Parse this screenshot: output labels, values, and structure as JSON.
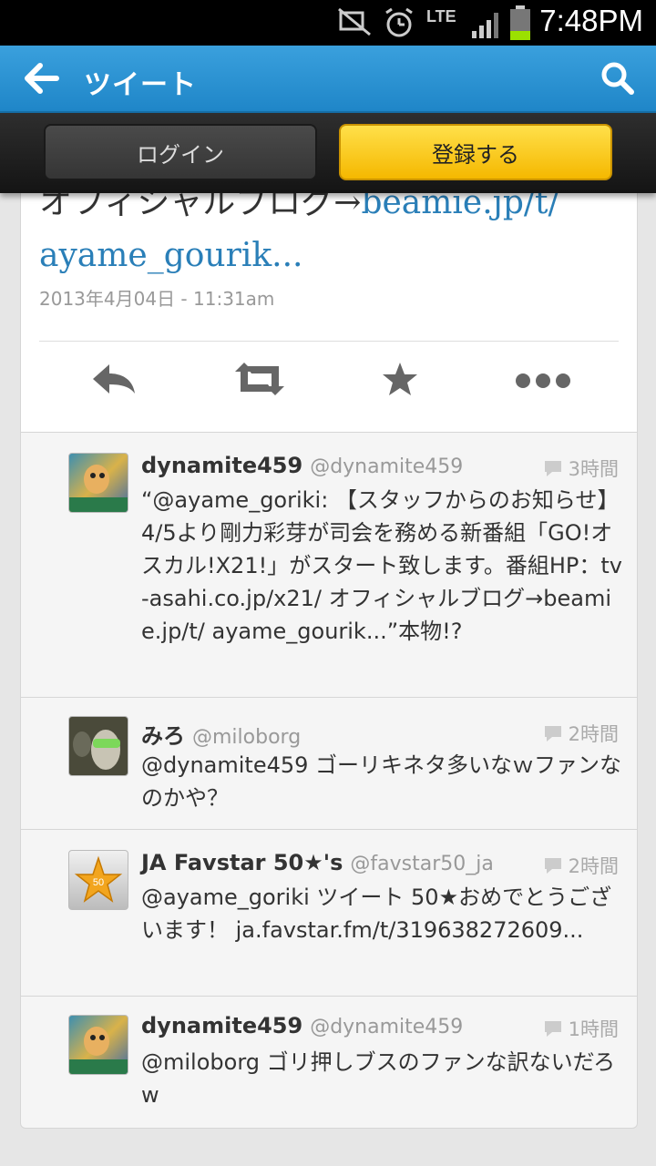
{
  "status_bar": {
    "network": "LTE",
    "time": "7:48PM",
    "icons": [
      "mute-icon",
      "alarm-icon",
      "lte-icon",
      "signal-icon",
      "battery-icon"
    ]
  },
  "app_bar": {
    "title": "ツイート",
    "icons": [
      "back-arrow-icon",
      "search-icon"
    ],
    "color": "#2a93d5"
  },
  "login_bar": {
    "login_label": "ログイン",
    "signup_label": "登録する",
    "signup_color": "#f7c100"
  },
  "tweet": {
    "text_tail_plain": "オフィシャルブログ→",
    "text_tail_link": "beamie.jp/t/",
    "text_tail_link2": "ayame_gourik...",
    "date": "2013年4月04日 - 11:31am",
    "link_color": "#2a7fb8",
    "actions": [
      "reply-icon",
      "retweet-icon",
      "favorite-star-icon",
      "more-icon"
    ]
  },
  "replies": [
    {
      "name": "dynamite459",
      "handle": "@dynamite459",
      "time": "3時間",
      "text": "“@ayame_goriki: 【スタッフからのお知らせ】4/5より剛力彩芽が司会を務める新番組「GO!オスカル!X21!」がスタート致します。番組HP：tv-asahi.co.jp/x21/ オフィシャルブログ→beamie.jp/t/ ayame_gourik...”本物!?"
    },
    {
      "name": "みろ",
      "handle": "@miloborg",
      "time": "2時間",
      "text": "@dynamite459 ゴーリキネタ多いなｗファンなのかや？"
    },
    {
      "name": "JA Favstar 50★'s",
      "handle": "@favstar50_ja",
      "time": "2時間",
      "text": "@ayame_goriki ツイート 50★おめでとうございます！ ja.favstar.fm/t/319638272609...",
      "avatar_label": "50"
    },
    {
      "name": "dynamite459",
      "handle": "@dynamite459",
      "time": "1時間",
      "text": "@miloborg ゴリ押しブスのファンな訳ないだろw"
    }
  ]
}
